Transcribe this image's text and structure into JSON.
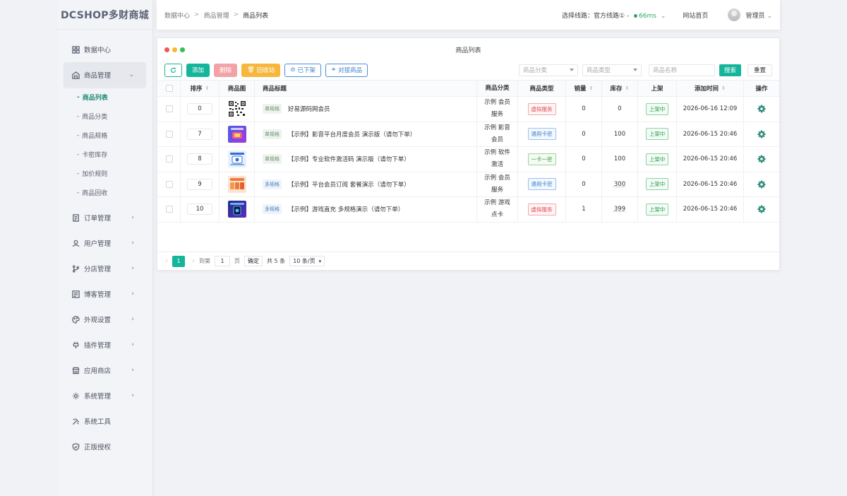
{
  "brand": "DCSHOP多财商城",
  "breadcrumb": [
    "数据中心",
    "商品管理",
    "商品列表"
  ],
  "topbar": {
    "route_label": "选择线路：官方线路① -",
    "route_ping": "66ms",
    "home_link": "网站首页",
    "user": "管理员"
  },
  "sidebar": {
    "items": [
      {
        "label": "数据中心",
        "icon": "dashboard-icon"
      },
      {
        "label": "商品管理",
        "icon": "bag-icon",
        "expanded": true
      },
      {
        "label": "订单管理",
        "icon": "order-icon"
      },
      {
        "label": "用户管理",
        "icon": "user-icon"
      },
      {
        "label": "分店管理",
        "icon": "branch-icon"
      },
      {
        "label": "博客管理",
        "icon": "blog-icon"
      },
      {
        "label": "外观设置",
        "icon": "palette-icon"
      },
      {
        "label": "插件管理",
        "icon": "plugin-icon"
      },
      {
        "label": "应用商店",
        "icon": "store-icon"
      },
      {
        "label": "系统管理",
        "icon": "gear-icon"
      },
      {
        "label": "系统工具",
        "icon": "tools-icon"
      },
      {
        "label": "正版授权",
        "icon": "shield-icon"
      }
    ],
    "submenu": [
      "商品列表",
      "商品分类",
      "商品规格",
      "卡密库存",
      "加价规则",
      "商品回收"
    ]
  },
  "panel": {
    "title": "商品列表",
    "buttons": {
      "add": "添加",
      "delete": "删除",
      "recycle": "回收站",
      "offshelf": "已下架",
      "connect": "对接商品"
    },
    "filters": {
      "category": "商品分类",
      "type": "商品类型",
      "name": "商品名称",
      "search": "搜索",
      "reset": "重置"
    }
  },
  "table": {
    "headers": {
      "sort": "排序",
      "image": "商品图",
      "title": "商品标题",
      "category": "商品分类",
      "type": "商品类型",
      "sales": "销量",
      "stock": "库存",
      "shelf": "上架",
      "time": "添加时间",
      "ops": "操作"
    },
    "rows": [
      {
        "sort": "0",
        "spec": "单规格",
        "title": "好易源码网会员",
        "cat1": "示例 会员",
        "cat2": "服务",
        "type": "虚拟服务",
        "sales": "0",
        "stock": "0",
        "shelf": "上架中",
        "time": "2026-06-16 12:09"
      },
      {
        "sort": "7",
        "spec": "单规格",
        "title": "【示例】影音平台月度会员 演示版（请勿下单）",
        "cat1": "示例 影音",
        "cat2": "会员",
        "type": "通用卡密",
        "sales": "0",
        "stock": "100",
        "shelf": "上架中",
        "time": "2026-06-15 20:46"
      },
      {
        "sort": "8",
        "spec": "单规格",
        "title": "【示例】专业软件激活码 演示版（请勿下单）",
        "cat1": "示例 软件",
        "cat2": "激活",
        "type": "一卡一密",
        "sales": "0",
        "stock": "100",
        "shelf": "上架中",
        "time": "2026-06-15 20:46"
      },
      {
        "sort": "9",
        "spec": "多规格",
        "title": "【示例】平台会员订阅 套餐演示（请勿下单）",
        "cat1": "示例 会员",
        "cat2": "服务",
        "type": "通用卡密",
        "sales": "0",
        "stock": "300",
        "shelf": "上架中",
        "time": "2026-06-15 20:46"
      },
      {
        "sort": "10",
        "spec": "多规格",
        "title": "【示例】游戏直充 多规格演示（请勿下单）",
        "cat1": "示例 游戏",
        "cat2": "点卡",
        "type": "虚拟服务",
        "sales": "1",
        "stock": "399",
        "shelf": "上架中",
        "time": "2026-06-15 20:46"
      }
    ]
  },
  "pager": {
    "current": "1",
    "goto_label": "到第",
    "page_input": "1",
    "page_unit": "页",
    "confirm": "确定",
    "total": "共 5 条",
    "page_size": "10 条/页"
  },
  "colors": {
    "accent": "#15b59b",
    "danger": "#f3a3a8",
    "warning": "#f6b73c",
    "link": "#3c7fcc"
  }
}
